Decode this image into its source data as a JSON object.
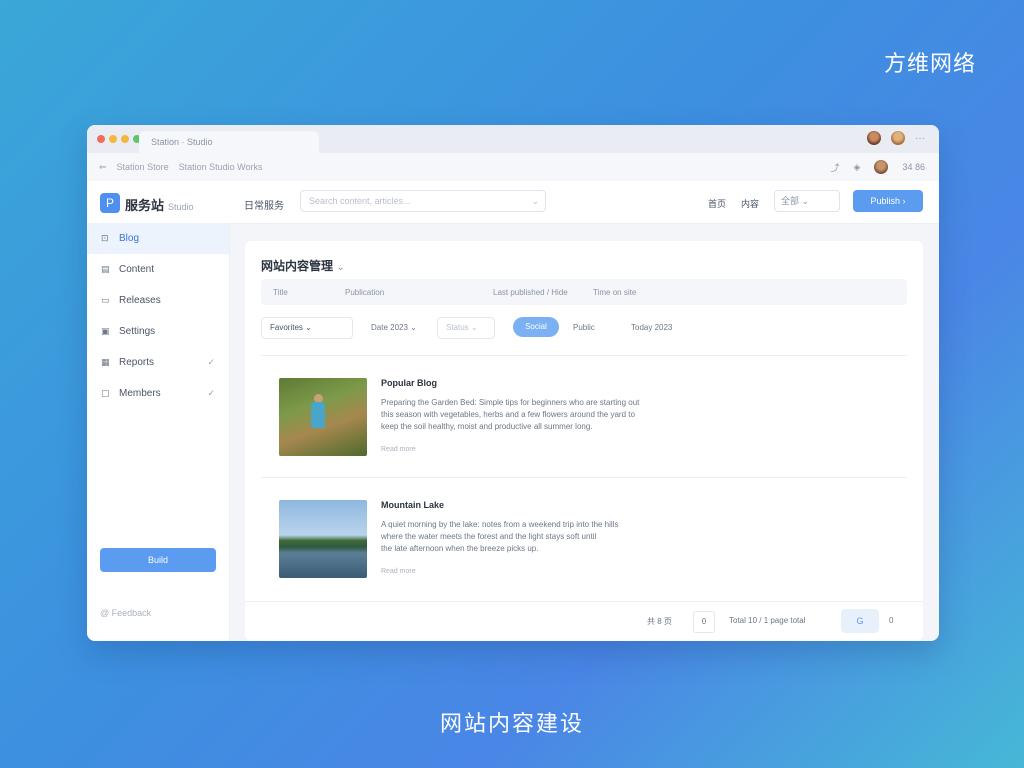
{
  "brand": "方维网络",
  "caption": "网站内容建设",
  "colors": {
    "accent": "#5b9bf0",
    "dot_red": "#f26b5b",
    "dot_yellow": "#f4b63f",
    "dot_green": "#5fc46a"
  },
  "window": {
    "tab_title": "Station · Studio",
    "menu_icon": "···",
    "nav_back": "⇐",
    "breadcrumb": [
      "Station Store",
      "Station Studio Works"
    ],
    "user_label": "34 86"
  },
  "topbar": {
    "logo_glyph": "P",
    "logo_text": "服务站",
    "logo_sub": "Studio",
    "search_label": "日常服务",
    "search_placeholder": "Search content, articles...",
    "search_chevron": "⌄",
    "link1": "首页",
    "link2": "内容",
    "select_value": "全部 ⌄",
    "primary_button": "Publish ›"
  },
  "sidebar": {
    "items": [
      {
        "icon": "⊡",
        "label": "Blog"
      },
      {
        "icon": "▤",
        "label": "Content"
      },
      {
        "icon": "▭",
        "label": "Releases"
      },
      {
        "icon": "▣",
        "label": "Settings"
      },
      {
        "icon": "▦",
        "label": "Reports",
        "chev": "✓"
      },
      {
        "icon": "▢",
        "label": "Members",
        "chev": "✓"
      }
    ],
    "button": "Build",
    "footer": "@ Feedback"
  },
  "main": {
    "title": "网站内容管理",
    "title_caret": "⌄",
    "columns": [
      "Title",
      "Publication",
      "Last published / Hide",
      "Time on site"
    ],
    "filters": {
      "select1": "Favorites ⌄",
      "text1": "Date 2023 ⌄",
      "select2": "Status ⌄",
      "active": "Social",
      "text2": "Public",
      "text3": "Today 2023"
    },
    "articles": [
      {
        "title": "Popular Blog",
        "lines": [
          "Preparing the Garden Bed: Simple tips for beginners who are starting out",
          "this season with vegetables, herbs and a few flowers around the yard to",
          "keep the soil healthy, moist and productive all summer long."
        ],
        "more": "Read more"
      },
      {
        "title": "Mountain Lake",
        "lines": [
          "A quiet morning by the lake: notes from a weekend trip into the hills",
          "where the water meets the forest and the light stays soft until",
          "the late afternoon when the breeze picks up."
        ],
        "more": "Read more"
      }
    ],
    "pager": {
      "label": "共 8 页",
      "page": "0",
      "per_page": "Total 10 / 1 page total",
      "go": "G",
      "next": "0"
    }
  }
}
